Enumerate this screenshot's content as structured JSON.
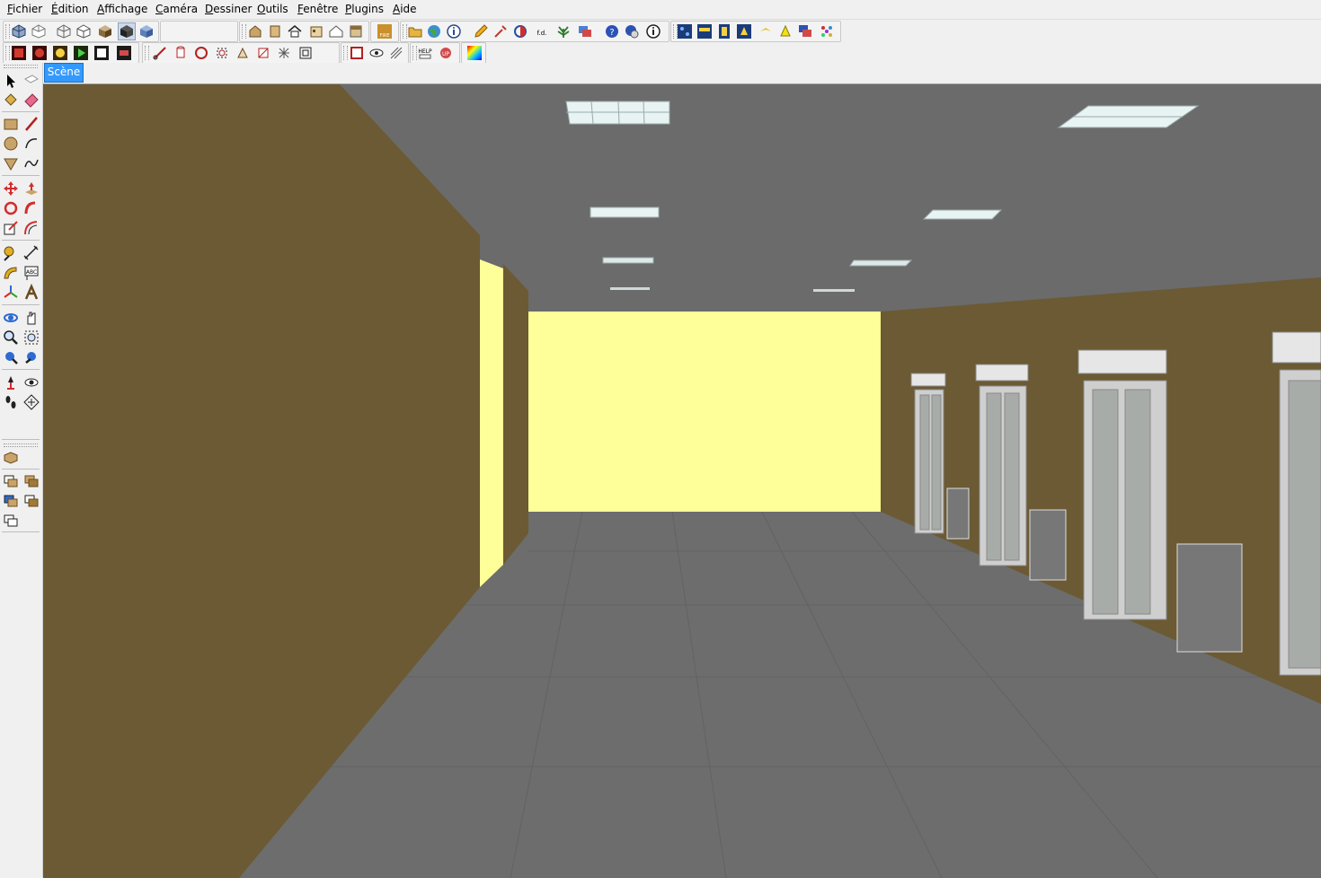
{
  "menubar": {
    "items": [
      {
        "label": "Fichier"
      },
      {
        "label": "Édition"
      },
      {
        "label": "Affichage"
      },
      {
        "label": "Caméra"
      },
      {
        "label": "Dessiner"
      },
      {
        "label": "Outils"
      },
      {
        "label": "Fenêtre"
      },
      {
        "label": "Plugins"
      },
      {
        "label": "Aide"
      }
    ]
  },
  "toolbar": {
    "help_badge": "HELP",
    "fd_badge": "f.d.",
    "fire_badge": "FIRE",
    "abc_badge": "ABC"
  },
  "scenes": {
    "tabs": [
      {
        "label": "Scène"
      }
    ]
  },
  "colors": {
    "wall": "#6b5a33",
    "ceiling": "#6b6b6b",
    "floor": "#6e6e6e",
    "lit_wall": "#ffff99",
    "selected_tab": "#3399ff"
  },
  "icons": {
    "left_toolbar": [
      "select-icon",
      "make-component-icon",
      "paint-bucket-icon",
      "eraser-icon",
      "rectangle-icon",
      "line-icon",
      "circle-icon",
      "arc-icon",
      "polygon-icon",
      "freehand-icon",
      "move-icon",
      "push-pull-icon",
      "rotate-icon",
      "follow-me-icon",
      "scale-icon",
      "offset-icon",
      "tape-measure-icon",
      "dimension-icon",
      "protractor-icon",
      "text-icon",
      "axes-icon",
      "3d-text-icon",
      "orbit-icon",
      "pan-icon",
      "zoom-icon",
      "zoom-window-icon",
      "zoom-extents-icon",
      "previous-view-icon",
      "position-camera-icon",
      "look-around-icon",
      "walk-icon",
      "section-plane-icon",
      "sandbox-icon",
      "sandbox-from-contours-icon",
      "sandbox-from-scratch-icon",
      "smoove-icon",
      "stamp-icon",
      "drape-icon"
    ]
  }
}
